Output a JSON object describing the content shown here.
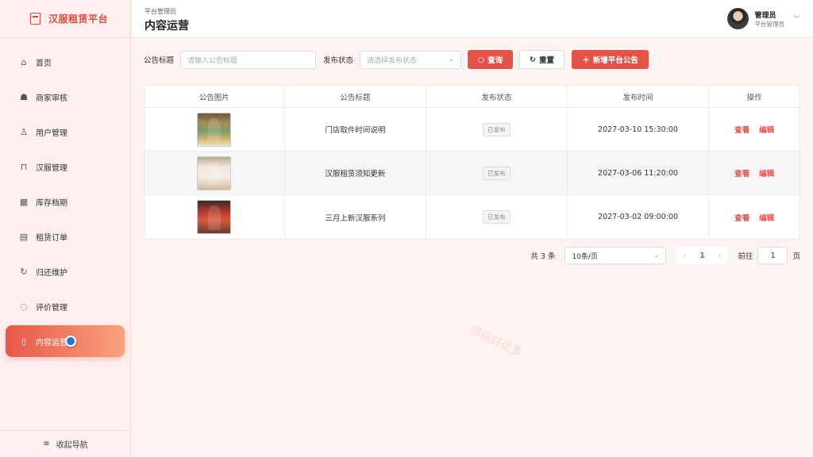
{
  "brand": {
    "title": "汉服租赁平台"
  },
  "sidebar": {
    "items": [
      {
        "label": "首页",
        "icon": "⌂"
      },
      {
        "label": "商家审核",
        "icon": "☗"
      },
      {
        "label": "用户管理",
        "icon": "♙"
      },
      {
        "label": "汉服管理",
        "icon": "⊓"
      },
      {
        "label": "库存档期",
        "icon": "▦"
      },
      {
        "label": "租赁订单",
        "icon": "▤"
      },
      {
        "label": "归还维护",
        "icon": "↻"
      },
      {
        "label": "评价管理",
        "icon": "◌"
      },
      {
        "label": "内容运营",
        "icon": "▯"
      }
    ],
    "active_index": 8,
    "collapse_label": "收起导航"
  },
  "header": {
    "breadcrumb": "平台管理员",
    "title": "内容运营",
    "user_name": "管理员",
    "user_role": "平台管理员"
  },
  "filters": {
    "title_label": "公告标题",
    "title_placeholder": "请输入公告标题",
    "status_label": "发布状态",
    "status_placeholder": "请选择发布状态",
    "search_label": "查询",
    "reset_label": "重置",
    "add_label": "新增平台公告"
  },
  "table": {
    "columns": [
      "公告图片",
      "公告标题",
      "发布状态",
      "发布时间",
      "操作"
    ],
    "rows": [
      {
        "title": "门店取件时间说明",
        "status": "已发布",
        "time": "2027-03-10 15:30:00"
      },
      {
        "title": "汉服租赁须知更新",
        "status": "已发布",
        "time": "2027-03-06 11:20:00"
      },
      {
        "title": "三月上新汉服系列",
        "status": "已发布",
        "time": "2027-03-02 09:00:00"
      }
    ],
    "action_view": "查看",
    "action_edit": "编辑"
  },
  "pagination": {
    "total": "共 3 条",
    "page_size": "10条/页",
    "current_page": "1",
    "goto_label": "前往",
    "goto_value": "1",
    "page_unit": "页"
  },
  "watermark": "源码好优多",
  "colors": {
    "accent": "#e2534a",
    "background": "#fdf3f1"
  }
}
